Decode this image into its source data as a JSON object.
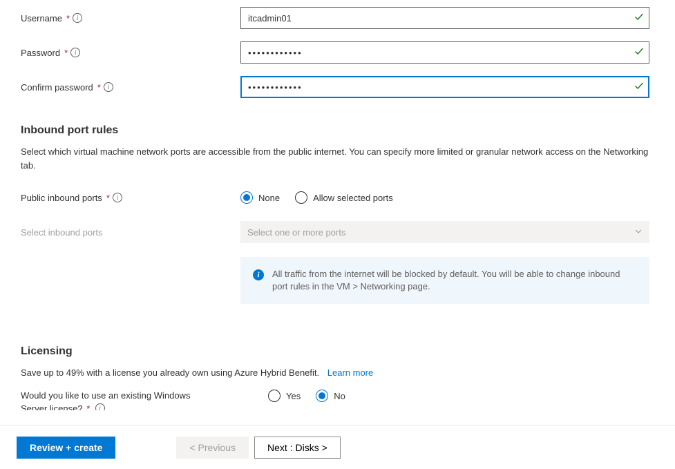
{
  "admin": {
    "username_label": "Username",
    "username_value": "itcadmin01",
    "password_label": "Password",
    "password_value": "••••••••••••",
    "confirm_label": "Confirm password",
    "confirm_value": "••••••••••••"
  },
  "inbound": {
    "title": "Inbound port rules",
    "desc": "Select which virtual machine network ports are accessible from the public internet. You can specify more limited or granular network access on the Networking tab.",
    "public_label": "Public inbound ports",
    "opt_none": "None",
    "opt_allow": "Allow selected ports",
    "select_label": "Select inbound ports",
    "select_placeholder": "Select one or more ports",
    "info_text": "All traffic from the internet will be blocked by default. You will be able to change inbound port rules in the VM > Networking page."
  },
  "licensing": {
    "title": "Licensing",
    "desc": "Save up to 49% with a license you already own using Azure Hybrid Benefit.",
    "learn_more": "Learn more",
    "question": "Would you like to use an existing Windows",
    "question_line2": "Server license?",
    "opt_yes": "Yes",
    "opt_no": "No"
  },
  "footer": {
    "review": "Review + create",
    "prev": "< Previous",
    "next": "Next : Disks >"
  }
}
